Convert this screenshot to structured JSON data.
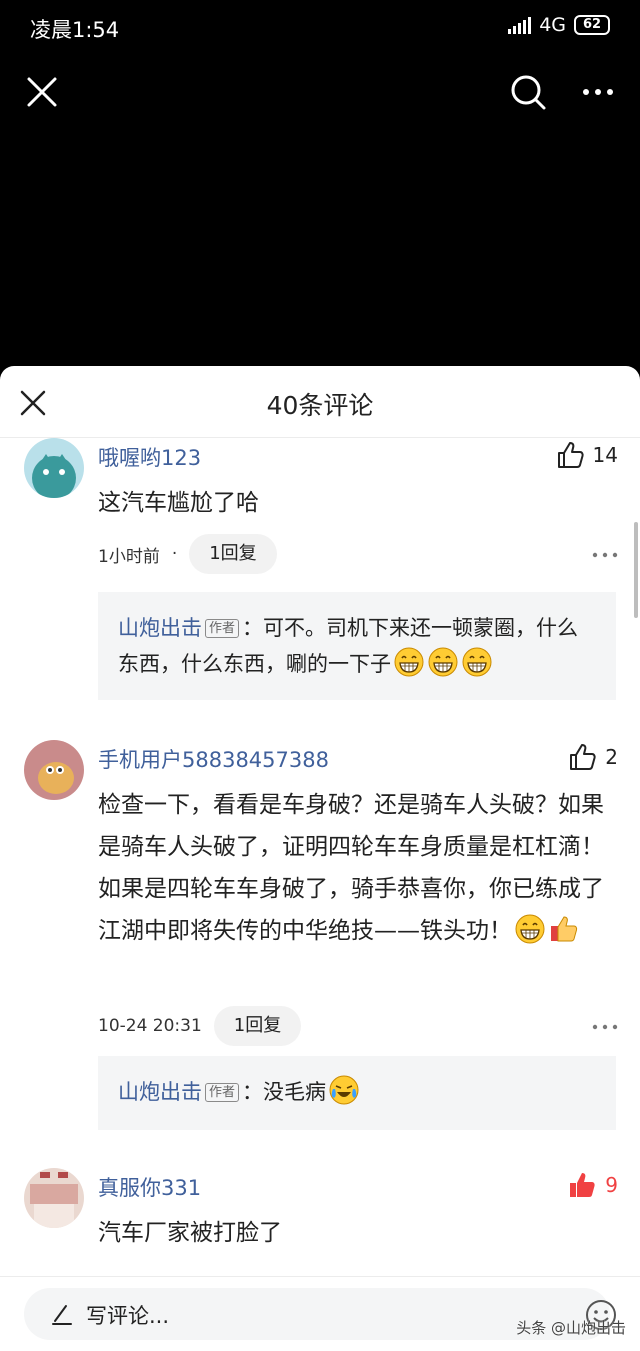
{
  "status_bar": {
    "time": "凌晨1:54",
    "network": "4G",
    "battery": "62"
  },
  "top_bar": {
    "close_icon": "close-icon",
    "search_icon": "search-icon",
    "more_icon": "more-icon"
  },
  "sheet": {
    "title": "40条评论"
  },
  "comments": [
    {
      "user": "哦喔哟123",
      "likes": "14",
      "liked": false,
      "text": "这汽车尴尬了哈",
      "time": "1小时前",
      "dot": "·",
      "reply_label": "1回复",
      "reply": {
        "author": "山炮出击",
        "tag": "作者",
        "sep": "：",
        "text": "可不。司机下来还一顿蒙圈，什么东西，什么东西，唰的一下子"
      }
    },
    {
      "user": "手机用户58838457388",
      "likes": "2",
      "liked": false,
      "text": "检查一下，看看是车身破？还是骑车人头破？如果是骑车人头破了，证明四轮车车身质量是杠杠滴！如果是四轮车车身破了，骑手恭喜你，你已练成了江湖中即将失传的中华绝技——铁头功！",
      "time": "10-24 20:31",
      "reply_label": "1回复",
      "reply": {
        "author": "山炮出击",
        "tag": "作者",
        "sep": "：",
        "text": "没毛病"
      }
    },
    {
      "user": "真服你331",
      "likes": "9",
      "liked": true,
      "text": "汽车厂家被打脸了"
    }
  ],
  "bottom_bar": {
    "placeholder": "写评论...",
    "watermark": "头条 @山炮出击"
  },
  "colors": {
    "username": "#40609b",
    "like_active": "#f04142",
    "reply_bg": "#f4f5f6"
  }
}
